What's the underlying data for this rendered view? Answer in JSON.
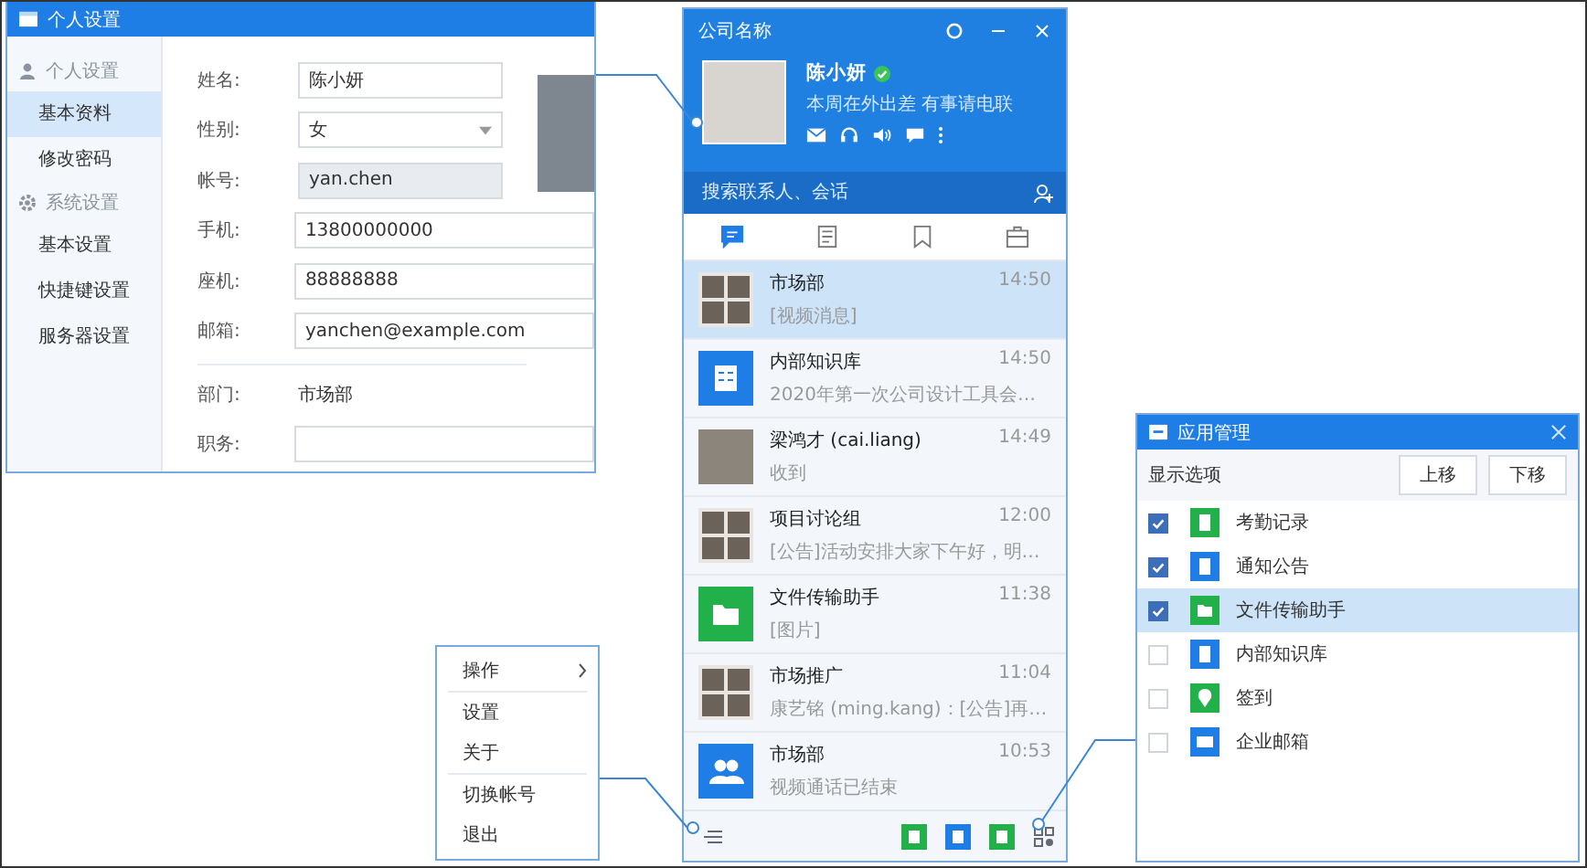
{
  "settings_window": {
    "title": "个人设置",
    "sidebar": [
      {
        "heading": "个人设置",
        "items": [
          {
            "label": "基本资料",
            "selected": true
          },
          {
            "label": "修改密码",
            "selected": false
          }
        ]
      },
      {
        "heading": "系统设置",
        "items": [
          {
            "label": "基本设置",
            "selected": false
          },
          {
            "label": "快捷键设置",
            "selected": false
          },
          {
            "label": "服务器设置",
            "selected": false
          }
        ]
      }
    ],
    "fields": [
      {
        "label": "姓名:",
        "kind": "text",
        "value": "陈小妍"
      },
      {
        "label": "性别:",
        "kind": "select",
        "value": "女"
      },
      {
        "label": "帐号:",
        "kind": "readonly",
        "value": "yan.chen"
      },
      {
        "label": "手机:",
        "kind": "wide",
        "value": "13800000000"
      },
      {
        "label": "座机:",
        "kind": "wide",
        "value": "88888888"
      },
      {
        "label": "邮箱:",
        "kind": "wide",
        "value": "yanchen@example.com"
      },
      {
        "label": "部门:",
        "kind": "static",
        "value": "市场部"
      },
      {
        "label": "职务:",
        "kind": "wide"
      }
    ]
  },
  "chat_window": {
    "title": "公司名称",
    "user": {
      "name": "陈小妍",
      "online": true,
      "status": "本周在外出差 有事请电联"
    },
    "search": {
      "placeholder": "搜索联系人、会话"
    },
    "tabs": [
      {
        "selected": true
      },
      {
        "selected": false
      },
      {
        "selected": false
      },
      {
        "selected": false
      }
    ],
    "conversations": [
      {
        "name": "市场部",
        "time": "14:50",
        "preview": "[视频消息]",
        "kind": "group",
        "selected": true
      },
      {
        "name": "内部知识库",
        "time": "14:50",
        "preview": "2020年第一次公司设计工具会…",
        "kind": "doc",
        "selected": false
      },
      {
        "name": "梁鸿才 (cai.liang)",
        "time": "14:49",
        "preview": "收到",
        "kind": "photo",
        "selected": false
      },
      {
        "name": "项目讨论组",
        "time": "12:00",
        "preview": "[公告]活动安排大家下午好，明…",
        "kind": "group",
        "selected": false
      },
      {
        "name": "文件传输助手",
        "time": "11:38",
        "preview": "[图片]",
        "kind": "folder",
        "selected": false
      },
      {
        "name": "市场推广",
        "time": "11:04",
        "preview": "康艺铭 (ming.kang)：[公告]再…",
        "kind": "group",
        "selected": false
      },
      {
        "name": "市场部",
        "time": "10:53",
        "preview": "视频通话已结束",
        "kind": "people",
        "selected": false
      }
    ],
    "bottom_apps": [
      {
        "color": "#22b04b"
      },
      {
        "color": "#1e7ee6"
      },
      {
        "color": "#22b04b"
      }
    ]
  },
  "menu": [
    {
      "label": "操作",
      "submenu": true,
      "divider": true
    },
    {
      "label": "设置",
      "submenu": false,
      "divider": false
    },
    {
      "label": "关于",
      "submenu": false,
      "divider": true
    },
    {
      "label": "切换帐号",
      "submenu": false,
      "divider": false
    },
    {
      "label": "退出",
      "submenu": false,
      "divider": false
    }
  ],
  "app_window": {
    "title": "应用管理",
    "label": "显示选项",
    "buttons": [
      "上移",
      "下移"
    ],
    "apps": [
      {
        "name": "考勤记录",
        "kind": "doc",
        "color": "#22b04b",
        "checked": true,
        "selected": false
      },
      {
        "name": "通知公告",
        "kind": "doc",
        "color": "#1e7ee6",
        "checked": true,
        "selected": false
      },
      {
        "name": "文件传输助手",
        "kind": "folder",
        "color": "#22b04b",
        "checked": true,
        "selected": true
      },
      {
        "name": "内部知识库",
        "kind": "doc",
        "color": "#1e7ee6",
        "checked": false,
        "selected": false
      },
      {
        "name": "签到",
        "kind": "pin",
        "color": "#22b04b",
        "checked": false,
        "selected": false
      },
      {
        "name": "企业邮箱",
        "kind": "mail",
        "color": "#1e7ee6",
        "checked": false,
        "selected": false
      }
    ]
  }
}
